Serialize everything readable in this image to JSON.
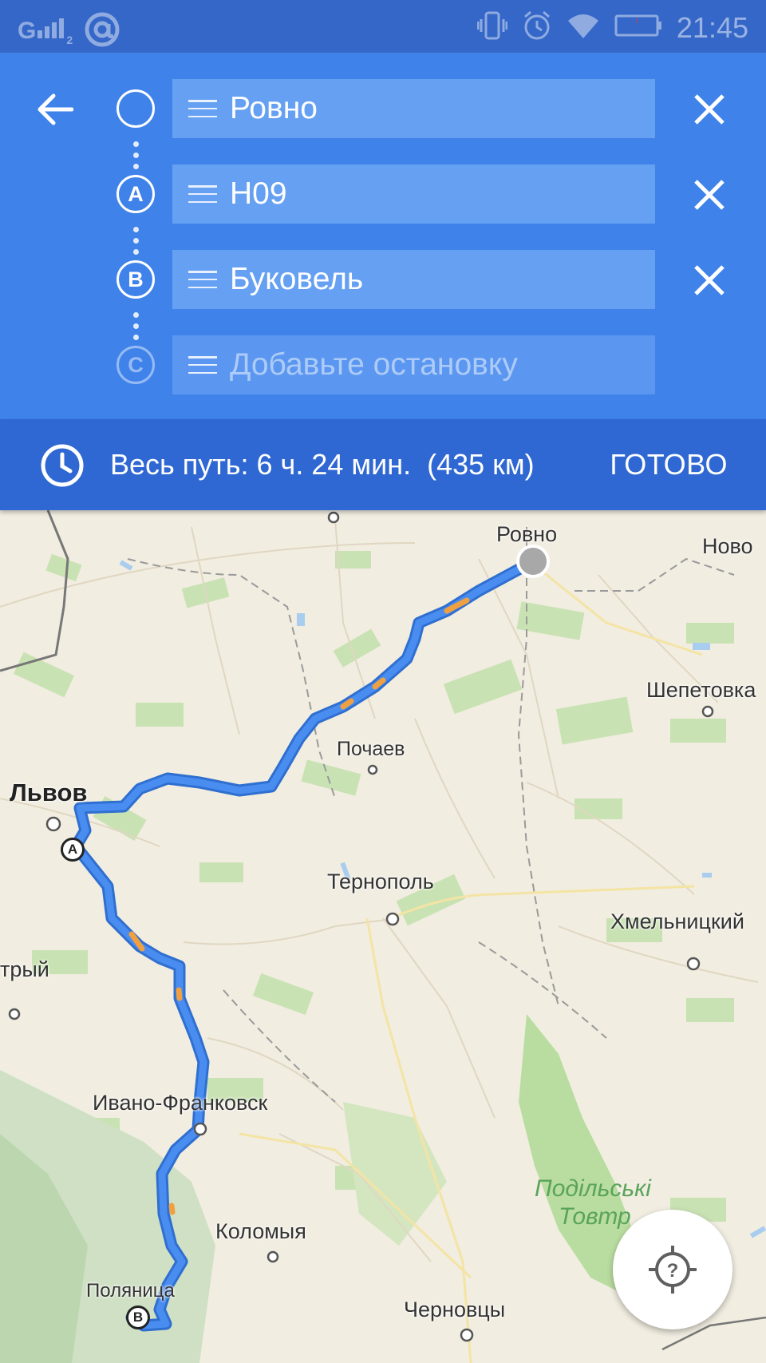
{
  "status_bar": {
    "signal": "G",
    "signal_sub": "2",
    "time": "21:45"
  },
  "route": {
    "stops": [
      {
        "marker": "",
        "value": "Ровно"
      },
      {
        "marker": "A",
        "value": "H09"
      },
      {
        "marker": "B",
        "value": "Буковель"
      }
    ],
    "add_stop": {
      "marker": "C",
      "placeholder": "Добавьте остановку"
    }
  },
  "summary": {
    "total": "Весь путь: 6 ч. 24 мин.",
    "distance": "(435 км)",
    "done_label": "ГОТОВО"
  },
  "map": {
    "route_markers": {
      "a": "A",
      "b": "B"
    },
    "places": {
      "rovno": "Ровно",
      "novo": "Ново",
      "shepetovka": "Шепетовка",
      "pochaev": "Почаев",
      "lvov": "Львов",
      "ternopol": "Тернополь",
      "khmelnitsky": "Хмельницкий",
      "stryi": "трый",
      "ivano_frankovsk": "Ивано-Франковск",
      "kolomyya": "Коломыя",
      "polyanitsa": "Поляница",
      "chernovtsy": "Черновцы",
      "podilski_1": "Подільські",
      "podilski_2": "Товтр"
    }
  },
  "colors": {
    "header": "#3f82ea",
    "summary_bar": "#2f67d3",
    "route_line": "#4a8df0",
    "traffic": "#f0a040"
  }
}
